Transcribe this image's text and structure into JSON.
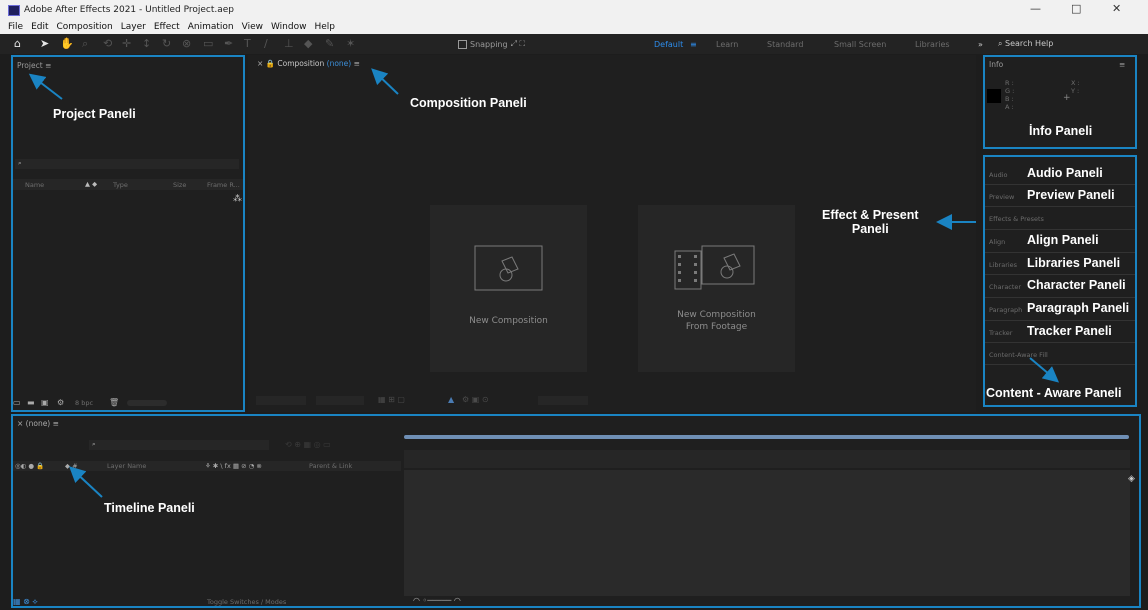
{
  "window": {
    "title": "Adobe After Effects 2021 - Untitled Project.aep",
    "controls": [
      "—",
      "□",
      "✕"
    ]
  },
  "menu": [
    "File",
    "Edit",
    "Composition",
    "Layer",
    "Effect",
    "Animation",
    "View",
    "Window",
    "Help"
  ],
  "toolbar": {
    "snapping_label": "Snapping",
    "workspaces": [
      "Default",
      "≡",
      "Learn",
      "Standard",
      "Small Screen",
      "Libraries"
    ],
    "active_workspace": "Default",
    "overflow": "»",
    "search_help": "Search Help"
  },
  "project_panel": {
    "title": "Project",
    "menu_icon": "≡",
    "columns": [
      "Name",
      "Type",
      "Size",
      "Frame R..."
    ],
    "footer_bpc": "8 bpc"
  },
  "composition_panel": {
    "tab_label": "Composition",
    "tab_value": "(none)",
    "menu_icon": "≡",
    "cards": [
      {
        "line1": "New Composition",
        "line2": ""
      },
      {
        "line1": "New Composition",
        "line2": "From Footage"
      }
    ]
  },
  "info_panel": {
    "title": "Info",
    "channels": [
      "R :",
      "G :",
      "B :",
      "A :"
    ],
    "coords": [
      "X :",
      "Y :"
    ]
  },
  "side_panels": [
    "Audio",
    "Preview",
    "Effects & Presets",
    "Align",
    "Libraries",
    "Character",
    "Paragraph",
    "Tracker",
    "Content-Aware Fill"
  ],
  "timeline_panel": {
    "tab": "(none)",
    "menu_icon": "≡",
    "layer_name_header": "Layer Name",
    "parent_header": "Parent & Link",
    "toggle_label": "Toggle Switches / Modes"
  },
  "annotations": {
    "project": "Project Paneli",
    "composition": "Composition Paneli",
    "info": "İnfo Paneli",
    "effect_line1": "Effect & Present",
    "effect_line2": "Paneli",
    "audio": "Audio  Paneli",
    "preview": "Preview  Paneli",
    "align": "Align Paneli",
    "libraries": "Libraries Paneli",
    "character": "Character Paneli",
    "paragraph": "Paragraph Paneli",
    "tracker": "Tracker Paneli",
    "content_aware": "Content - Aware Paneli",
    "timeline": "Timeline Paneli"
  },
  "colors": {
    "annotation_border": "#1a84c3",
    "arrow": "#1a84c3",
    "accent_blue": "#2d8ceb",
    "panel_bg": "#1f1f1f"
  }
}
